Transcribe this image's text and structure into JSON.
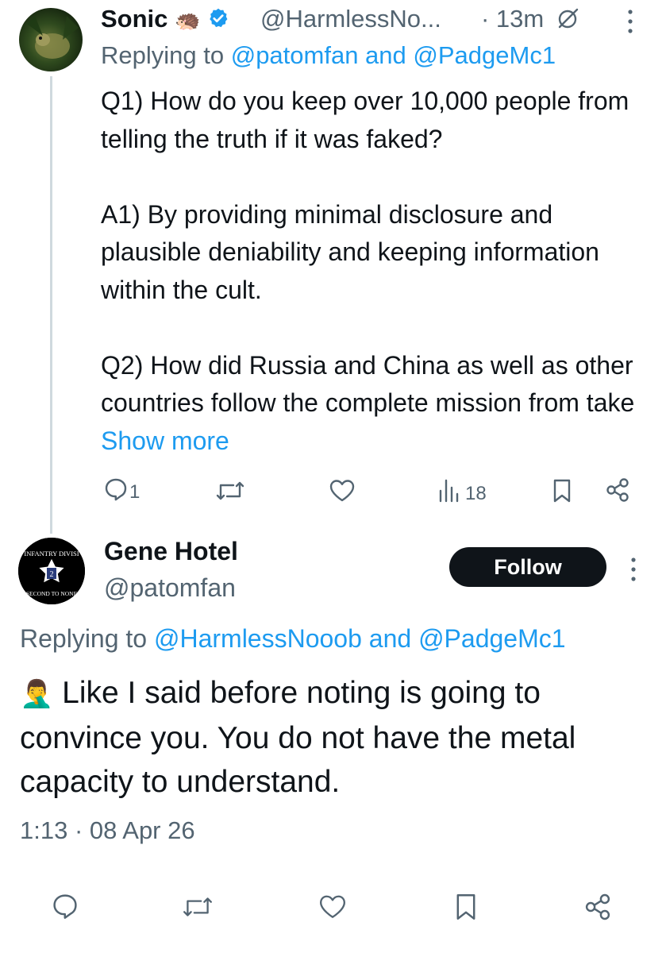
{
  "reply_tweet": {
    "author": {
      "name": "Sonic",
      "name_emoji": "🦔",
      "verified": true,
      "handle": "@HarmlessNo...",
      "time": "· 13m"
    },
    "replying_prefix": "Replying to ",
    "replying_to": "@patomfan and @PadgeMc1",
    "text": "Q1) How do you keep over 10,000 people from telling the truth if it was faked?\n\nA1) By providing minimal disclosure and plausible deniability and keeping information within the cult.\n\nQ2) How did Russia and China as well as other countries follow the complete mission from take ",
    "show_more": "Show more",
    "actions": {
      "reply_count": "1",
      "view_count": "18"
    }
  },
  "main_tweet": {
    "author": {
      "name": "Gene Hotel",
      "handle": "@patomfan",
      "avatar_text_top": "INFANTRY DIVISI",
      "avatar_text_bottom": "SECOND TO NONE"
    },
    "follow_label": "Follow",
    "replying_prefix": "Replying to ",
    "replying_to": "@HarmlessNooob and @PadgeMc1",
    "emoji": "🤦‍♂️",
    "text": " Like I said before noting is going to convince you. You do not have the metal capacity to understand.",
    "timestamp": "1:13 · 08 Apr 26"
  },
  "icons": [
    "muted-icon",
    "more-icon",
    "reply-icon",
    "retweet-icon",
    "like-icon",
    "views-icon",
    "bookmark-icon",
    "share-icon"
  ],
  "colors": {
    "accent": "#1d9bf0",
    "text": "#0f1419",
    "secondary": "#536471",
    "line": "#cfd9de"
  }
}
